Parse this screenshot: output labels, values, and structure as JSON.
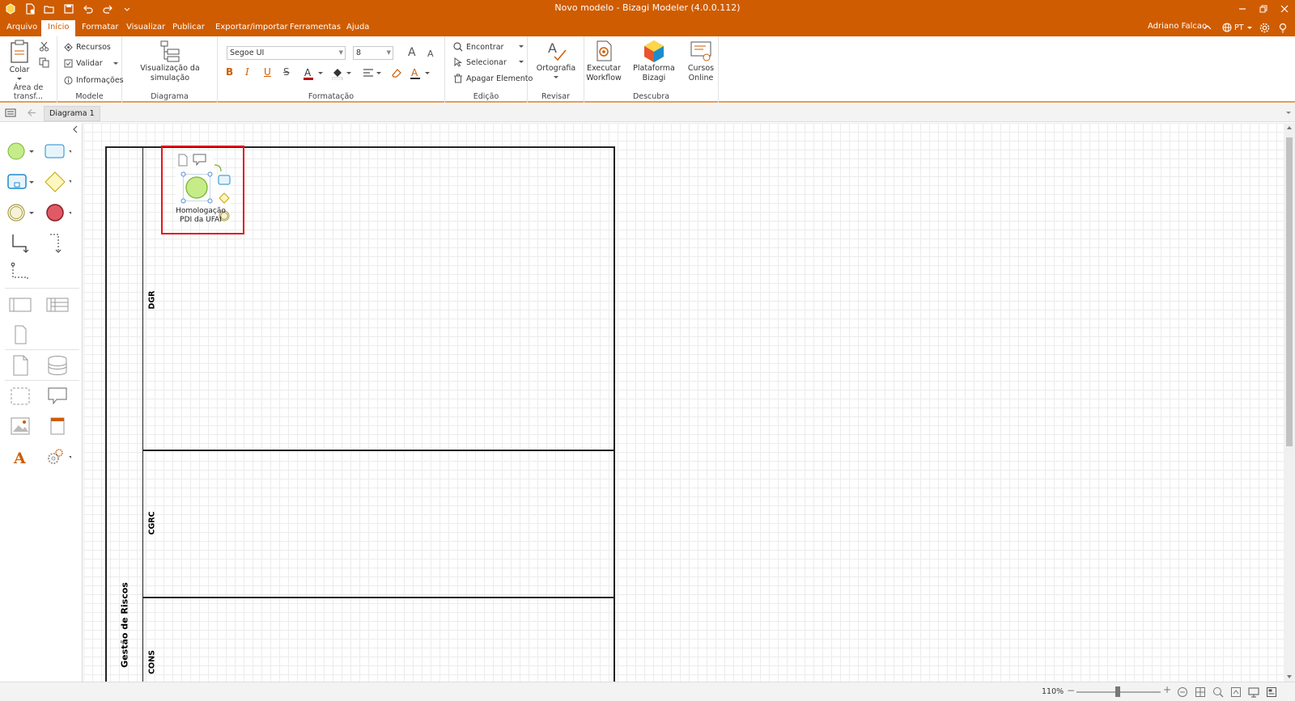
{
  "window": {
    "title": "Novo modelo - Bizagi Modeler (4.0.0.112)"
  },
  "menu": {
    "items": [
      {
        "label": "Arquivo"
      },
      {
        "label": "Início"
      },
      {
        "label": "Formatar"
      },
      {
        "label": "Visualizar"
      },
      {
        "label": "Publicar"
      },
      {
        "label": "Exportar/importar"
      },
      {
        "label": "Ferramentas"
      },
      {
        "label": "Ajuda"
      }
    ],
    "active": "Início",
    "user": "Adriano Falcao",
    "language": "PT"
  },
  "ribbon": {
    "clipboard": {
      "paste": "Colar",
      "label": "Área de transf..."
    },
    "model": {
      "resources": "Recursos",
      "validate": "Validar",
      "info": "Informações",
      "label": "Modele"
    },
    "diagram": {
      "simulation": "Visualização da simulação",
      "label": "Diagrama"
    },
    "format": {
      "font": "Segoe UI",
      "size": "8",
      "label": "Formatação"
    },
    "edit": {
      "find": "Encontrar",
      "select": "Selecionar",
      "delete": "Apagar Elemento",
      "label": "Edição"
    },
    "review": {
      "spelling": "Ortografia",
      "label": "Revisar"
    },
    "discover": {
      "workflow_l1": "Executar",
      "workflow_l2": "Workflow",
      "platform": "Plataforma Bizagi",
      "courses_l1": "Cursos",
      "courses_l2": "Online",
      "label": "Descubra"
    }
  },
  "doc_tab": "Diagrama 1",
  "diagram": {
    "pool": "Gestão de Riscos",
    "lanes": [
      "DGR",
      "CGRC",
      "CONS"
    ],
    "event_label_l1": "Homologação",
    "event_label_l2": "PDI da UFAI"
  },
  "status": {
    "zoom": "110%"
  },
  "colors": {
    "brand": "#cf5c00",
    "selection": "#e0161e",
    "start_event": "#c6ec8a"
  }
}
